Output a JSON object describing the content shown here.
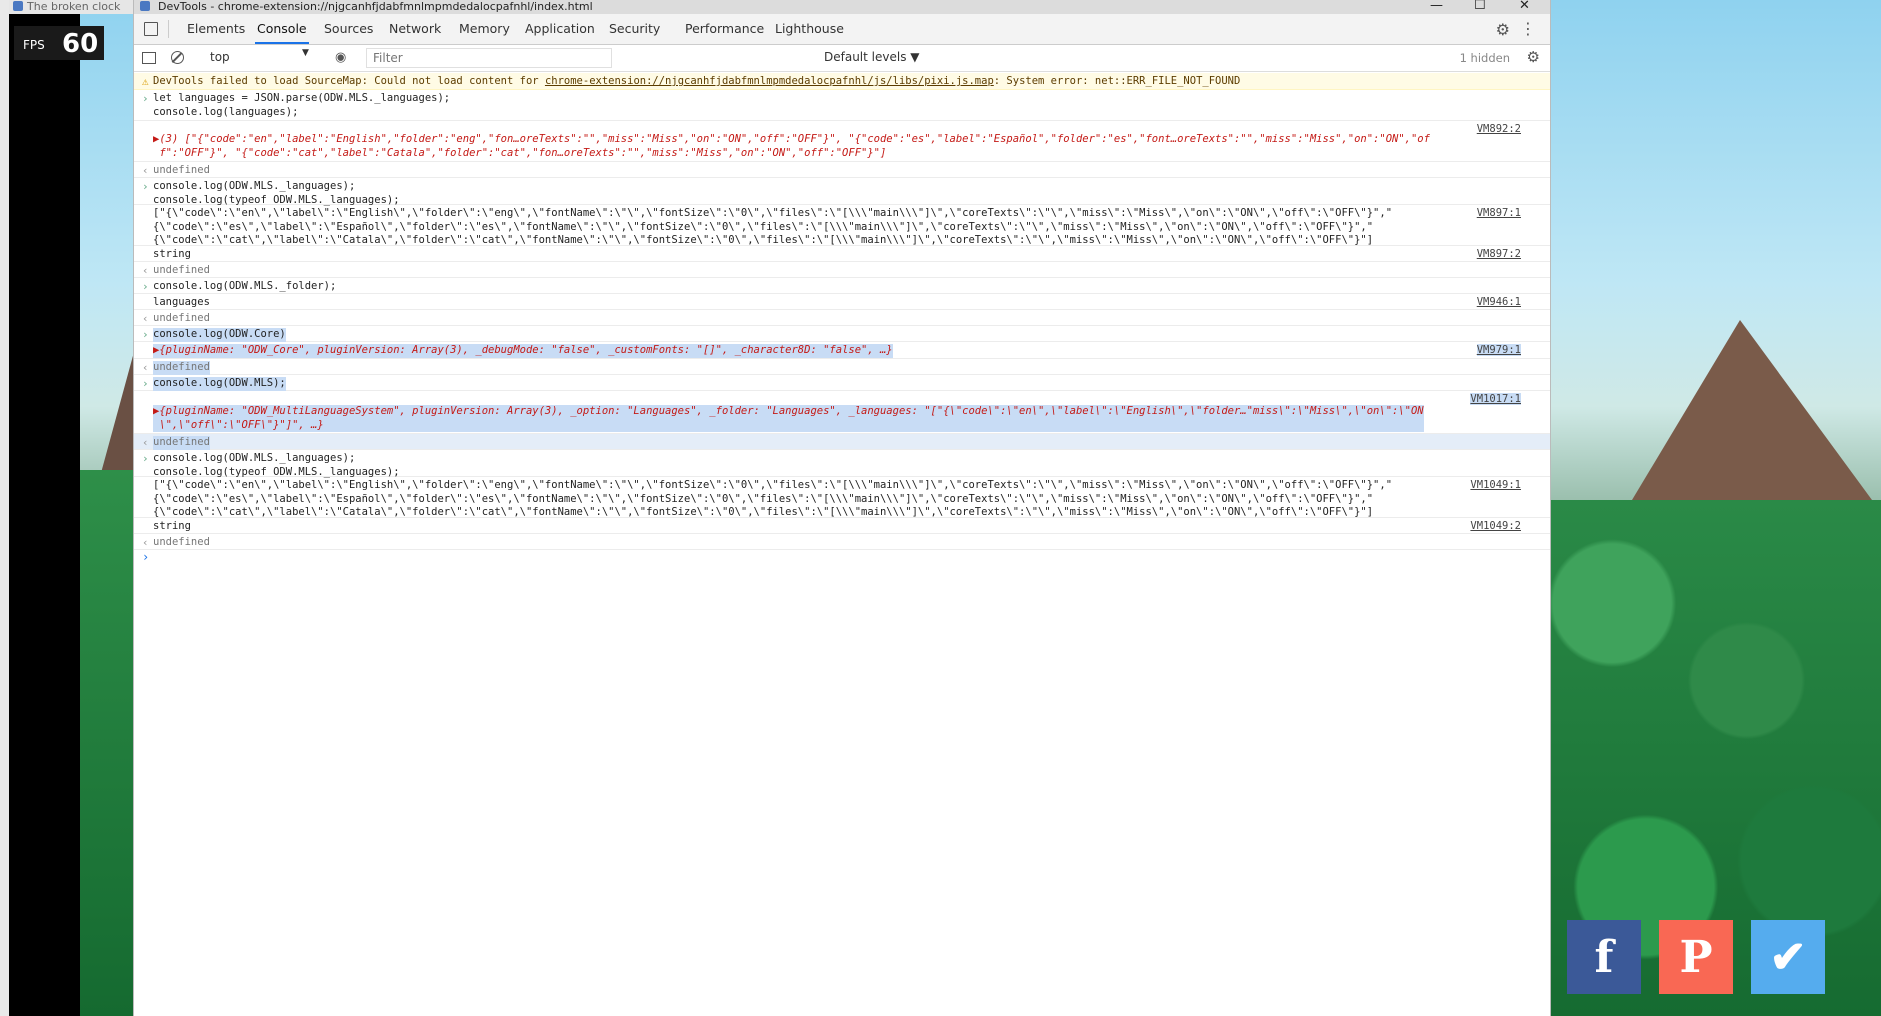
{
  "game": {
    "fps_label": "FPS",
    "fps_value": "60",
    "social": [
      {
        "name": "facebook-icon",
        "glyph": "f"
      },
      {
        "name": "patreon-icon",
        "glyph": "P"
      },
      {
        "name": "twitter-icon",
        "glyph": "✔"
      }
    ],
    "prev_tab_title": "The broken clock"
  },
  "window": {
    "title": "DevTools - chrome-extension://njgcanhfjdabfmnlmpmdedalocpafnhl/index.html",
    "controls": [
      "—",
      "☐",
      "✕"
    ]
  },
  "tabs": [
    {
      "label": "Elements",
      "active": false
    },
    {
      "label": "Console",
      "active": true
    },
    {
      "label": "Sources",
      "active": false
    },
    {
      "label": "Network",
      "active": false
    },
    {
      "label": "Memory",
      "active": false
    },
    {
      "label": "Application",
      "active": false
    },
    {
      "label": "Security",
      "active": false
    },
    {
      "label": "Performance",
      "active": false
    },
    {
      "label": "Lighthouse",
      "active": false
    }
  ],
  "console_bar": {
    "context": "top",
    "filter_placeholder": "Filter",
    "levels": "Default levels ▼",
    "hidden": "1 hidden"
  },
  "console": {
    "warning": {
      "prefix": "DevTools failed to load SourceMap: Could not load content for ",
      "link": "chrome-extension://njgcanhfjdabfmnlmpmdedalocpafnhl/js/libs/pixi.js.map",
      "suffix": ": System error: net::ERR_FILE_NOT_FOUND"
    },
    "cmd1": "let languages = JSON.parse(ODW.MLS._languages);\nconsole.log(languages);",
    "src1": "VM892:2",
    "out1": "▶(3) [\"{\"code\":\"en\",\"label\":\"English\",\"folder\":\"eng\",\"fon…oreTexts\":\"\",\"miss\":\"Miss\",\"on\":\"ON\",\"off\":\"OFF\"}\", \"{\"code\":\"es\",\"label\":\"Español\",\"folder\":\"es\",\"font…oreTexts\":\"\",\"miss\":\"Miss\",\"on\":\"ON\",\"of\n f\":\"OFF\"}\", \"{\"code\":\"cat\",\"label\":\"Catala\",\"folder\":\"cat\",\"fon…oreTexts\":\"\",\"miss\":\"Miss\",\"on\":\"ON\",\"off\":\"OFF\"}\"]",
    "undefined": "undefined",
    "cmd2": "console.log(ODW.MLS._languages);\nconsole.log(typeof ODW.MLS._languages);",
    "src2a": "VM897:1",
    "out2a": "[\"{\\\"code\\\":\\\"en\\\",\\\"label\\\":\\\"English\\\",\\\"folder\\\":\\\"eng\\\",\\\"fontName\\\":\\\"\\\",\\\"fontSize\\\":\\\"0\\\",\\\"files\\\":\\\"[\\\\\\\"main\\\\\\\"]\\\",\\\"coreTexts\\\":\\\"\\\",\\\"miss\\\":\\\"Miss\\\",\\\"on\\\":\\\"ON\\\",\\\"off\\\":\\\"OFF\\\"}\",\"\n{\\\"code\\\":\\\"es\\\",\\\"label\\\":\\\"Español\\\",\\\"folder\\\":\\\"es\\\",\\\"fontName\\\":\\\"\\\",\\\"fontSize\\\":\\\"0\\\",\\\"files\\\":\\\"[\\\\\\\"main\\\\\\\"]\\\",\\\"coreTexts\\\":\\\"\\\",\\\"miss\\\":\\\"Miss\\\",\\\"on\\\":\\\"ON\\\",\\\"off\\\":\\\"OFF\\\"}\",\"\n{\\\"code\\\":\\\"cat\\\",\\\"label\\\":\\\"Catala\\\",\\\"folder\\\":\\\"cat\\\",\\\"fontName\\\":\\\"\\\",\\\"fontSize\\\":\\\"0\\\",\\\"files\\\":\\\"[\\\\\\\"main\\\\\\\"]\\\",\\\"coreTexts\\\":\\\"\\\",\\\"miss\\\":\\\"Miss\\\",\\\"on\\\":\\\"ON\\\",\\\"off\\\":\\\"OFF\\\"}\"]",
    "string": "string",
    "src2b": "VM897:2",
    "cmd3": "console.log(ODW.MLS._folder);",
    "out3": "languages",
    "src3": "VM946:1",
    "cmd4": "console.log(ODW.Core)",
    "out4": "▶{pluginName: \"ODW_Core\", pluginVersion: Array(3), _debugMode: \"false\", _customFonts: \"[]\", _character8D: \"false\", …}",
    "src4": "VM979:1",
    "cmd5": "console.log(ODW.MLS);",
    "src5": "VM1017:1",
    "out5": "▶{pluginName: \"ODW_MultiLanguageSystem\", pluginVersion: Array(3), _option: \"Languages\", _folder: \"Languages\", _languages: \"[\"{\\\"code\\\":\\\"en\\\",\\\"label\\\":\\\"English\\\",\\\"folder…\"miss\\\":\\\"Miss\\\",\\\"on\\\":\\\"ON\n \\\",\\\"off\\\":\\\"OFF\\\"}\"]\", …}",
    "cmd6": "console.log(ODW.MLS._languages);\nconsole.log(typeof ODW.MLS._languages);",
    "src6a": "VM1049:1",
    "src6b": "VM1049:2",
    "caret": "›"
  }
}
